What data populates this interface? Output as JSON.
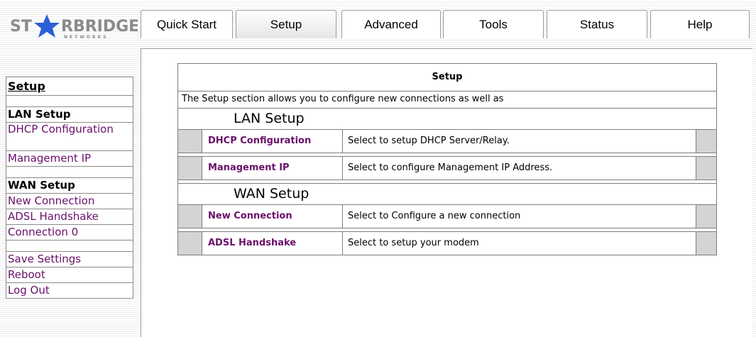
{
  "logo": {
    "brand_text": "ST",
    "brand_text2": "RBRIDGE",
    "sub_text": "NETWORKS",
    "star_color": "#2a5fd8"
  },
  "tabs": [
    {
      "label": "Quick Start",
      "active": false
    },
    {
      "label": "Setup",
      "active": true
    },
    {
      "label": "Advanced",
      "active": false
    },
    {
      "label": "Tools",
      "active": false
    },
    {
      "label": "Status",
      "active": false
    },
    {
      "label": "Help",
      "active": false
    }
  ],
  "sidebar": {
    "title": "Setup",
    "lan_heading": "LAN Setup",
    "dhcp": "DHCP Configuration",
    "mgmt": "Management IP",
    "wan_heading": "WAN Setup",
    "new_conn": "New Connection",
    "adsl": "ADSL Handshake",
    "conn0": "Connection 0",
    "save": "Save Settings",
    "reboot": "Reboot",
    "logout": "Log Out"
  },
  "main": {
    "title": "Setup",
    "description": "The Setup section allows you to configure new connections as well as",
    "lan_section": "LAN Setup",
    "wan_section": "WAN Setup",
    "rows": [
      {
        "link": "DHCP Configuration",
        "desc": "Select to setup DHCP Server/Relay."
      },
      {
        "link": "Management IP",
        "desc": "Select to configure Management IP Address."
      },
      {
        "link": "New Connection",
        "desc": "Select to Configure a new connection"
      },
      {
        "link": "ADSL Handshake",
        "desc": "Select to setup your modem"
      }
    ]
  },
  "colors": {
    "link": "#6a0f6a",
    "cell_gray": "#d4d4d4",
    "border": "#7d7d7d"
  }
}
